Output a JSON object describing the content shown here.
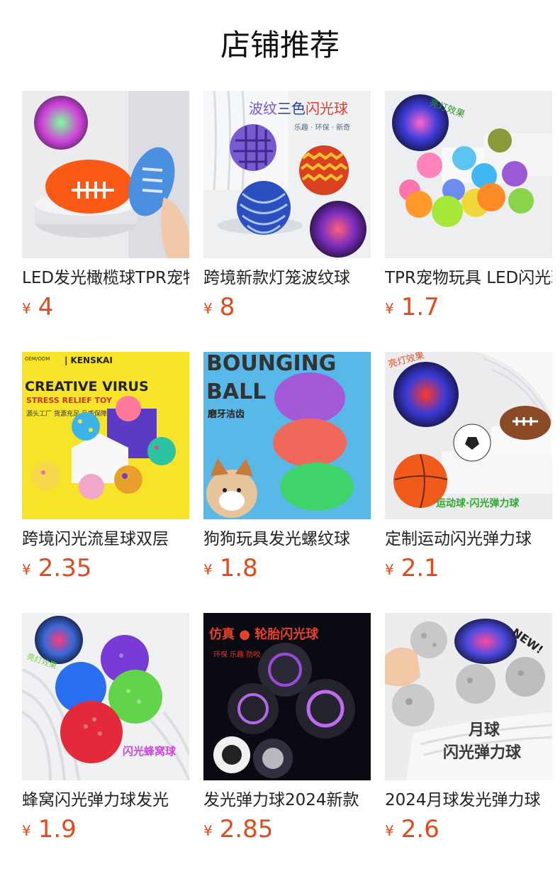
{
  "section_title": "店铺推荐",
  "colors": {
    "price": "#e4491b",
    "title": "#111111",
    "text": "#222222"
  },
  "products": [
    {
      "name": "LED发光橄榄球TPR宠物玩具",
      "currency": "¥",
      "price": "4",
      "image": "glowing-rugby-balls-photo"
    },
    {
      "name": "跨境新款灯笼波纹球",
      "currency": "¥",
      "price": "8",
      "image": "three-color-flash-balls-photo",
      "image_text": {
        "headline": "波纹三色闪光球",
        "tagline": "乐趣 · 环保 · 新奇"
      }
    },
    {
      "name": "TPR宠物玩具 LED闪光球",
      "currency": "¥",
      "price": "1.7",
      "image": "spiky-flash-balls-photo",
      "image_text": {
        "badge": "亮灯效果"
      }
    },
    {
      "name": "跨境闪光流星球双层",
      "currency": "¥",
      "price": "2.35",
      "image": "virus-stress-balls-photo",
      "image_text": {
        "brand": "KENSKAI",
        "headline": "CREATIVE VIRUS",
        "sub": "STRESS RELIEF TOY",
        "note": "源头工厂 货源充足 品质保障"
      }
    },
    {
      "name": "狗狗玩具发光螺纹球",
      "currency": "¥",
      "price": "1.8",
      "image": "bouncing-ball-dog-photo",
      "image_text": {
        "headline_1": "BOUNGING",
        "headline_2": "BALL",
        "sub": "磨牙洁齿"
      }
    },
    {
      "name": "定制运动闪光弹力球",
      "currency": "¥",
      "price": "2.1",
      "image": "sport-flash-balls-photo",
      "image_text": {
        "badge": "亮灯效果",
        "caption": "运动球·闪光弹力球"
      }
    },
    {
      "name": "蜂窝闪光弹力球发光",
      "currency": "¥",
      "price": "1.9",
      "image": "honeycomb-flash-balls-photo",
      "image_text": {
        "badge": "亮灯效果",
        "caption": "闪光蜂窝球"
      }
    },
    {
      "name": "发光弹力球2024新款",
      "currency": "¥",
      "price": "2.85",
      "image": "tire-flash-balls-photo",
      "image_text": {
        "headline": "仿真 ● 轮胎闪光球",
        "tagline": "环保  乐趣  防咬"
      }
    },
    {
      "name": "2024月球发光弹力球",
      "currency": "¥",
      "price": "2.6",
      "image": "moon-flash-balls-photo",
      "image_text": {
        "badge": "NEW!",
        "caption_1": "月球",
        "caption_2": "闪光弹力球"
      }
    }
  ]
}
